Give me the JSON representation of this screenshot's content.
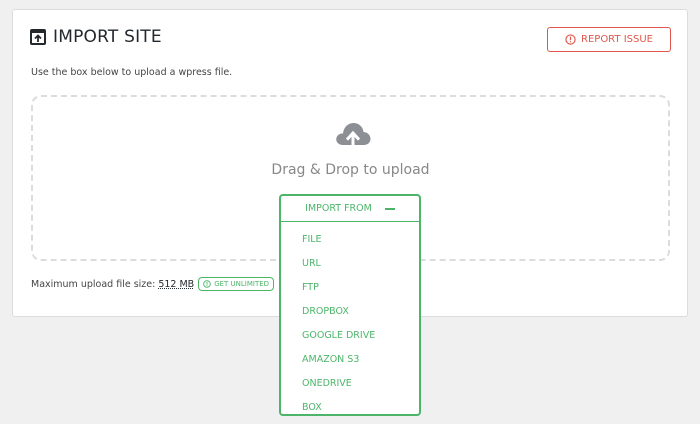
{
  "header": {
    "title": "IMPORT SITE",
    "title_icon": "import-box-arrow-icon",
    "report_button": {
      "label": "REPORT ISSUE",
      "icon": "alert-circle-icon"
    }
  },
  "instructions": "Use the box below to upload a wpress file.",
  "dropzone": {
    "icon": "cloud-upload-icon",
    "text": "Drag & Drop to upload"
  },
  "upload_limit": {
    "label": "Maximum upload file size:",
    "value": "512 MB",
    "badge": {
      "label": "GET UNLIMITED",
      "icon": "alert-circle-icon"
    }
  },
  "import_menu": {
    "label": "IMPORT FROM",
    "toggle_icon": "minus-icon",
    "items": [
      {
        "label": "FILE"
      },
      {
        "label": "URL"
      },
      {
        "label": "FTP"
      },
      {
        "label": "DROPBOX"
      },
      {
        "label": "GOOGLE DRIVE"
      },
      {
        "label": "AMAZON S3"
      },
      {
        "label": "ONEDRIVE"
      },
      {
        "label": "BOX"
      }
    ]
  },
  "colors": {
    "accent_green": "#4cb56a",
    "danger_red": "#e2574c",
    "border_grey": "#dcdcde",
    "background": "#f0f0f1"
  }
}
